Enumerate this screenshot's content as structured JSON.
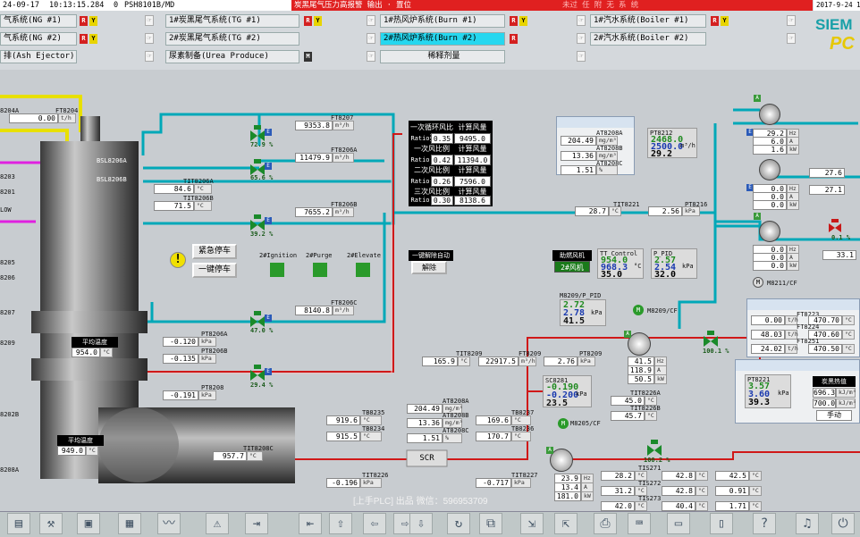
{
  "header": {
    "date": "24-09-17",
    "time": "10:13:15.284",
    "code": "0",
    "tag": "PSH8101B/MD",
    "alarm": "炭黑尾气压力高报警 输出 · 置位",
    "alarm_right": "未过 任 附 无 系 统",
    "clock": "2017-9-24 10",
    "logo_top": "SIEM",
    "logo_bottom": "PC",
    "systems": [
      {
        "label": "气系统(NG #1)"
      },
      {
        "label": "气系统(NG #2)"
      },
      {
        "label": "排(Ash Ejector)"
      },
      {
        "label": "1#炭黑尾气系统(TG #1)"
      },
      {
        "label": "2#炭黑尾气系统(TG #2)"
      },
      {
        "label": "尿素制备(Urea Produce)"
      },
      {
        "label": "1#热风炉系统(Burn #1)"
      },
      {
        "label": "2#热风炉系统(Burn #2)"
      },
      {
        "label": "稀释剂量"
      },
      {
        "label": "1#汽水系统(Boiler #1)"
      },
      {
        "label": "2#汽水系统(Boiler #2)"
      }
    ],
    "marks": {
      "r": "R",
      "y": "Y",
      "m": "M"
    }
  },
  "left": {
    "ft8204_tag": "FT8204",
    "ft8204a_tag": "8204A",
    "ft8204_val": "0.00",
    "ft8204_unit": "t/h",
    "tags": [
      "8203",
      "8202",
      "8201",
      "LOW",
      "8205",
      "8206",
      "8207",
      "8208",
      "8209",
      "8202B",
      "8208A"
    ],
    "avg_temp_label": "平均温度",
    "avg_temp_val": "954.0",
    "avg_temp_unit": "°C",
    "avg_temp2_label": "平均温度",
    "avg_temp2_val": "949.0",
    "avg_temp2_unit": "°C",
    "bsl_a": "BSL8206A",
    "bsl_b": "BSL8206B"
  },
  "center": {
    "ft8207_tag": "FT8207",
    "ft8207_val": "9353.8",
    "ft8207_unit": "m³/h",
    "ft8206a_tag": "FT8206A",
    "ft8206a_val": "11479.9",
    "ft8206a_unit": "m³/h",
    "tit8206a_tag": "TIT8206A",
    "tit8206a_val": "84.6",
    "tit8206a_unit": "°C",
    "tit8206b_tag": "TIT8206B",
    "tit8206b_val": "71.5",
    "tit8206b_unit": "°C",
    "ft8206b_tag": "FT8206B",
    "ft8206b_val": "7655.2",
    "ft8206b_unit": "m³/h",
    "ft8206c_tag": "FT8206C",
    "ft8206c_val": "8140.8",
    "ft8206c_unit": "m³/h",
    "pt8206a_tag": "PT8206A",
    "pt8206a_val": "-0.120",
    "pt8206a_unit": "kPa",
    "pt8206b_tag": "PT8206B",
    "pt8206b_val": "-0.135",
    "pt8206b_unit": "kPa",
    "pt8208_tag": "PT8208",
    "pt8208_val": "-0.191",
    "pt8208_unit": "kPa",
    "tit8208c_tag": "TIT8208C",
    "tit8208c_val": "957.7",
    "tit8208c_unit": "°C",
    "valve_pcts": [
      "72.9 %",
      "65.6 %",
      "39.2 %",
      "47.0 %",
      "29.4 %"
    ],
    "estop_label": "紧急停车",
    "onekey_label": "一键停车",
    "ignition": "2#Ignition",
    "purge": "2#Purge",
    "elevate": "2#Elevate"
  },
  "ratio": {
    "rows": [
      {
        "title": "一次循环风比例",
        "calc": "计算风量",
        "ratio": "0.35",
        "value": "9495.0"
      },
      {
        "title": "一次风比例",
        "calc": "计算风量",
        "ratio": "0.42",
        "value": "11394.0"
      },
      {
        "title": "二次风比例",
        "calc": "计算风量",
        "ratio": "0.26",
        "value": "7596.0"
      },
      {
        "title": "三次风比例",
        "calc": "计算风量",
        "ratio": "0.30",
        "value": "8138.6"
      }
    ],
    "ratio_tag": "Ratio",
    "auto_label": "一键解除自动",
    "release_label": "解除"
  },
  "mid": {
    "tit8209_tag": "TIT8209",
    "tit8209_val": "165.9",
    "tit8209_unit": "°C",
    "ft8209_tag": "FT8209",
    "ft8209_val": "22917.5",
    "ft8209_unit": "m³/h",
    "pt8209_tag": "PT8209",
    "pt8209_val": "2.76",
    "pt8209_unit": "kPa",
    "tb8235_tag": "TB8235",
    "tb8235_val": "919.6",
    "tb8235_unit": "°C",
    "tb8234_tag": "TB8234",
    "tb8234_val": "915.5",
    "tb8234_unit": "°C",
    "tit8226_tag": "TIT8226",
    "tit8226_val": "-0.196",
    "tit8226_unit": "kPa",
    "at8208a_tag": "AT8208A",
    "at8208a_val": "204.49",
    "at8208a_unit": "mg/m³",
    "at8208b_tag": "AT8208B",
    "at8208b_val": "13.36",
    "at8208b_unit": "mg/m³",
    "at8208c_tag": "AT8208C",
    "at8208c_val": "1.51",
    "at8208c_unit": "%",
    "scr_label": "SCR",
    "tb8237_tag": "TB8237",
    "tb8237_val": "169.6",
    "tb8237_unit": "°C",
    "tb8236_tag": "TB8236",
    "tb8236_val": "170.7",
    "tb8236_unit": "°C",
    "tit8227_tag": "TIT8227",
    "tit8227_val": "-0.717",
    "tit8227_unit": "kPa",
    "sc8281_tag": "SC8281",
    "sc8281_v1": "-0.190",
    "sc8281_v2": "-0.200",
    "sc8281_v3": "23.5",
    "sc8281_unit": "kPa",
    "m8205_tag": "M8205/CF",
    "m8205_v": [
      "23.9",
      "13.4",
      "181.0"
    ],
    "m8205_u": [
      "Hz",
      "A",
      "kW"
    ],
    "m8209_tag": "M8209/CF",
    "m8209_pid": "M8209/P_PID",
    "m8209_v1": "2.72",
    "m8209_v2": "2.78",
    "m8209_v3": "41.5",
    "m8209_unit": "kPa",
    "m8209_r": [
      "41.5",
      "118.9",
      "50.5"
    ],
    "m8209_ru": [
      "Hz",
      "A",
      "kW"
    ],
    "valve_pct2": "100.1 %",
    "valve_pct3": "100.2 %",
    "tit8221_tag": "TIT8221",
    "tit8221_val": "28.7",
    "tit8221_unit": "°C",
    "pt8216_tag": "PT8216",
    "pt8216_val": "2.56",
    "pt8216_unit": "kPa",
    "tit8226a_tag": "TIT8226A",
    "tit8226a_val": "45.0",
    "tit8226a_unit": "°C",
    "tit8226b_tag": "TIT8226B",
    "tit8226b_val": "45.7",
    "tit8226b_unit": "°C",
    "fan_label": "助燃风机",
    "fan_btn": "2#风机",
    "tt_ctrl": "TT_Control",
    "tt_v1": "954.0",
    "tt_v2": "968.3",
    "tt_v3": "35.0",
    "tt_unit": "°C",
    "p_pid": "P_PID",
    "p_v1": "2.57",
    "p_v2": "2.54",
    "p_v3": "32.0",
    "p_unit": "kPa"
  },
  "popups": {
    "at_a_tag": "AT8208A",
    "at_a_val": "204.49",
    "at_a_unit": "mg/m³",
    "at_b_tag": "AT8208B",
    "at_b_val": "13.36",
    "at_b_unit": "mg/m³",
    "at_c_tag": "AT8208C",
    "at_c_val": "1.51",
    "at_c_unit": "%",
    "pt8212_tag": "PT8212",
    "pt8212_v1": "2468.0",
    "pt8212_v2": "2500.0",
    "pt8212_v3": "29.2",
    "pt8212_unit": "m³/h",
    "pt8221_tag": "PT8221",
    "pt8221_v1": "3.57",
    "pt8221_v2": "3.60",
    "pt8221_v3": "39.3",
    "pt8221_unit": "kPa",
    "heat_label": "炭黑热值",
    "heat_v1": "696.3",
    "heat_v2": "700.0",
    "heat_unit": "kJ/m³",
    "manual_label": "手动"
  },
  "right": {
    "pump1": [
      "29.2",
      "6.0",
      "1.6"
    ],
    "pump1_u": [
      "Hz",
      "A",
      "kW"
    ],
    "pump2": [
      "0.0",
      "0.0",
      "0.0"
    ],
    "pump2_u": [
      "Hz",
      "A",
      "kW"
    ],
    "pump3": [
      "0.0",
      "0.0",
      "0.0"
    ],
    "pump3_u": [
      "Hz",
      "A",
      "kW"
    ],
    "m8211": "M8211/CF",
    "rv1": "27.6",
    "rv2": "27.1",
    "rv3": "33.1",
    "valve_pct": "0.1 %",
    "table": [
      [
        "0.00",
        "470.70"
      ],
      [
        "48.03",
        "470.60"
      ],
      [
        "24.02",
        "470.50"
      ]
    ],
    "table_tags": [
      "FT8223",
      "FT8224",
      "FT8251",
      "TIT8235"
    ],
    "table_units": [
      "t/h",
      "°C"
    ],
    "bottom": [
      {
        "tag": "TIS271",
        "a": "28.2",
        "b": "42.8",
        "c": "42.5",
        "u": "°C"
      },
      {
        "tag": "TIS272",
        "a": "31.2",
        "b": "42.8",
        "c": "0.91",
        "u": "°C"
      },
      {
        "tag": "TIS273",
        "a": "42.0",
        "b": "40.4",
        "c": "1.71",
        "u": "°C"
      }
    ]
  },
  "watermark": "[上手PLC] 出品 微信：596953709",
  "toolbar_icons": [
    "recipe-icon",
    "tools-icon",
    "folder-icon",
    "report-icon",
    "trend-icon",
    "alarm-icon",
    "export-icon",
    "nav-first-icon",
    "nav-up-icon",
    "nav-back-icon",
    "nav-fwd-icon",
    "nav-down-icon",
    "refresh-icon",
    "copy-icon",
    "login-icon",
    "logout-icon",
    "print-icon",
    "keyboard-icon",
    "save-icon",
    "help-icon",
    "speaker-icon",
    "exit-icon"
  ]
}
